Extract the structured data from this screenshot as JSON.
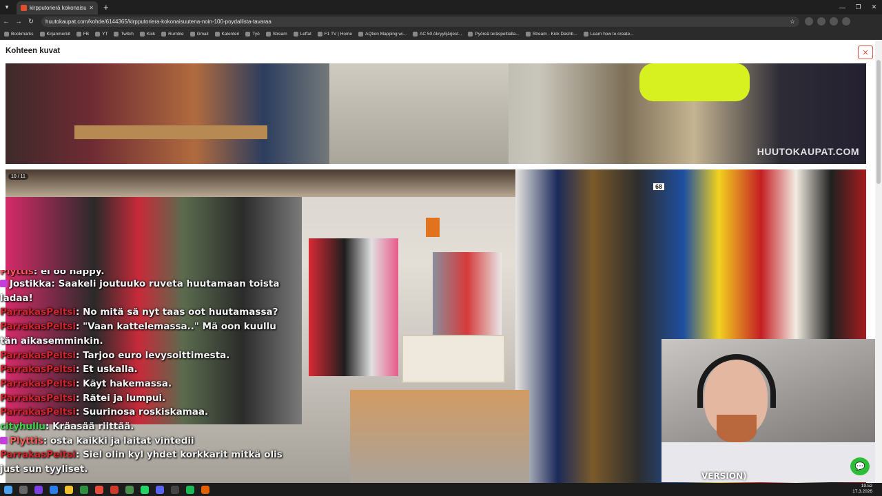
{
  "browser": {
    "tab_title": "kirpputorierä kokonaisuutena -",
    "url": "huutokaupat.com/kohde/6144365/kirpputoriera-kokonaisuutena-noin-100-poydallista-tavaraa",
    "bookmarks": [
      {
        "label": "Bookmarks"
      },
      {
        "label": "Kirjanmerkit"
      },
      {
        "label": "FB"
      },
      {
        "label": "YT"
      },
      {
        "label": "Twitch"
      },
      {
        "label": "Kick"
      },
      {
        "label": "Rumble"
      },
      {
        "label": "Gmail"
      },
      {
        "label": "Kalenteri"
      },
      {
        "label": "Työ"
      },
      {
        "label": "Stream"
      },
      {
        "label": "Leffat"
      },
      {
        "label": "F1 TV | Home"
      },
      {
        "label": "AQtion Mapping wi..."
      },
      {
        "label": "AC 50 Akryylijärjest..."
      },
      {
        "label": "Pyöreä teräspeltialla..."
      },
      {
        "label": "Stream - Kick Dashb..."
      },
      {
        "label": "Learn how to create..."
      }
    ]
  },
  "page": {
    "title": "Kohteen kuvat",
    "close_symbol": "✕",
    "photo1_watermark": "HUUTOKAUPAT.COM",
    "photo2_counter": "10 / 11",
    "photo2_price_label": "68"
  },
  "chat": [
    {
      "user": "Plyttis",
      "text": ": ei oo happy.",
      "color": "#ff5a5a",
      "heart": false,
      "cut": true
    },
    {
      "user": "Jostikka",
      "text": ": Saakeli joutuuko ruveta huutamaan toista ladaa!",
      "color": "#ffffff",
      "heart": true
    },
    {
      "user": "ParrakasPeltsi",
      "text": ": No mitä sä nyt taas oot huutamassa?",
      "color": "#d1242a",
      "heart": false
    },
    {
      "user": "ParrakasPeltsi",
      "text": ": \"Vaan kattelemassa..\" Mä oon kuullu tän aikasemminkin.",
      "color": "#d1242a",
      "heart": false
    },
    {
      "user": "ParrakasPeltsi",
      "text": ": Tarjoo euro levysoittimesta.",
      "color": "#d1242a",
      "heart": false
    },
    {
      "user": "ParrakasPeltsi",
      "text": ": Et uskalla.",
      "color": "#d1242a",
      "heart": false
    },
    {
      "user": "ParrakasPeltsi",
      "text": ": Käyt hakemassa.",
      "color": "#d1242a",
      "heart": false
    },
    {
      "user": "ParrakasPeltsi",
      "text": ": Rätei ja lumpui.",
      "color": "#d1242a",
      "heart": false
    },
    {
      "user": "ParrakasPeltsi",
      "text": ": Suurinosa roskiskamaa.",
      "color": "#d1242a",
      "heart": false
    },
    {
      "user": "cityhullu",
      "text": ": Kräasää riittää.",
      "color": "#3fd24a",
      "heart": false
    },
    {
      "user": "Plyttis",
      "text": ": osta kaikki ja laitat vintedii",
      "color": "#ff5a5a",
      "heart": true
    },
    {
      "user": "ParrakasPeltsi",
      "text": ": Siel olin kyl yhdet korkkarit mitkä olis just sun tyyliset.",
      "color": "#d1242a",
      "heart": false
    }
  ],
  "webcam": {
    "caption": "VERSION)"
  },
  "taskbar": {
    "time": "19.52",
    "date": "17.3.2026"
  },
  "colors": {
    "accent_close": "#e05a47",
    "chat_bubble": "#2ebd38"
  }
}
